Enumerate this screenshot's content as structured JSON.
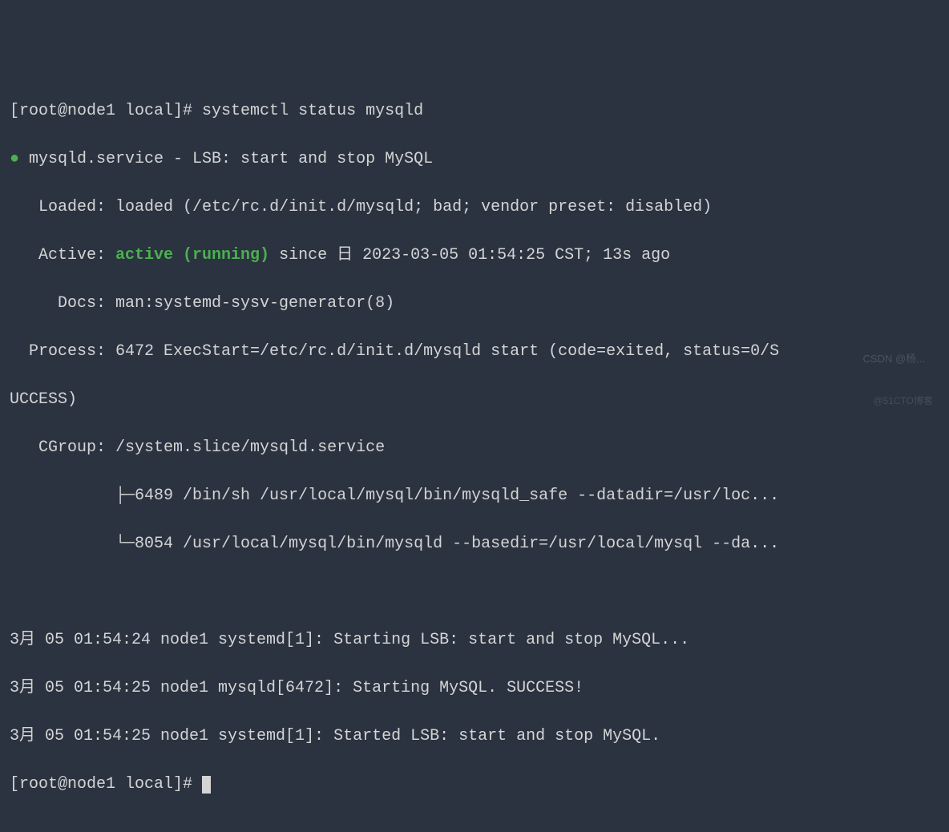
{
  "prompt1": "[root@node1 local]# ",
  "command": "systemctl status mysqld",
  "bullet": "●",
  "service_line": " mysqld.service - LSB: start and stop MySQL",
  "loaded_label": "   Loaded: ",
  "loaded_value": "loaded (/etc/rc.d/init.d/mysqld; bad; vendor preset: disabled)",
  "active_label": "   Active: ",
  "active_status": "active (running)",
  "active_rest": " since 日 2023-03-05 01:54:25 CST; 13s ago",
  "docs_line": "     Docs: man:systemd-sysv-generator(8)",
  "process_line": "  Process: 6472 ExecStart=/etc/rc.d/init.d/mysqld start (code=exited, status=0/S",
  "process_cont": "UCCESS)",
  "cgroup_line": "   CGroup: /system.slice/mysqld.service",
  "cgroup_child1": "           ├─6489 /bin/sh /usr/local/mysql/bin/mysqld_safe --datadir=/usr/loc...",
  "cgroup_child2": "           └─8054 /usr/local/mysql/bin/mysqld --basedir=/usr/local/mysql --da...",
  "blank": " ",
  "log1": "3月 05 01:54:24 node1 systemd[1]: Starting LSB: start and stop MySQL...",
  "log2": "3月 05 01:54:25 node1 mysqld[6472]: Starting MySQL. SUCCESS!",
  "log3": "3月 05 01:54:25 node1 systemd[1]: Started LSB: start and stop MySQL.",
  "prompt2": "[root@node1 local]# ",
  "watermark1": "CSDN @杨...",
  "watermark2": "@51CTO博客"
}
